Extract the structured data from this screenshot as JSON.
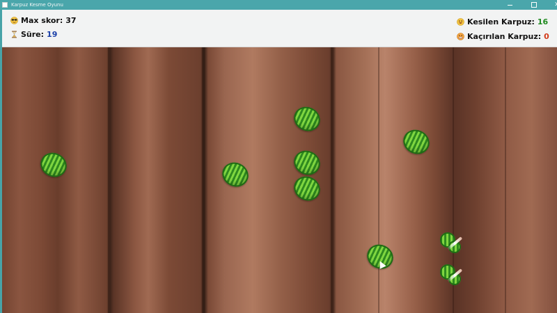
{
  "window": {
    "title": "Karpuz Kesme Oyunu"
  },
  "hud": {
    "max_skor": {
      "label": "Max skor:",
      "value": "37",
      "icon": "sunglasses-face-icon"
    },
    "sure": {
      "label": "Süre:",
      "value": "19",
      "icon": "hourglass-icon"
    },
    "kesilen": {
      "label": "Kesilen Karpuz:",
      "value": "16",
      "icon": "grinning-face-icon"
    },
    "kacirilan": {
      "label": "Kaçırılan Karpuz:",
      "value": "0",
      "icon": "grimacing-face-icon"
    }
  },
  "colors": {
    "titlebar": "#4aa6ab",
    "hud_bg": "#f2f3f3",
    "sure_value": "#1a3fa8",
    "kesilen_value": "#1f8a1f",
    "kacirilan_value": "#d33a1a",
    "melon_stripe_dark": "#2f8a1f",
    "melon_stripe_light": "#7fd640"
  }
}
